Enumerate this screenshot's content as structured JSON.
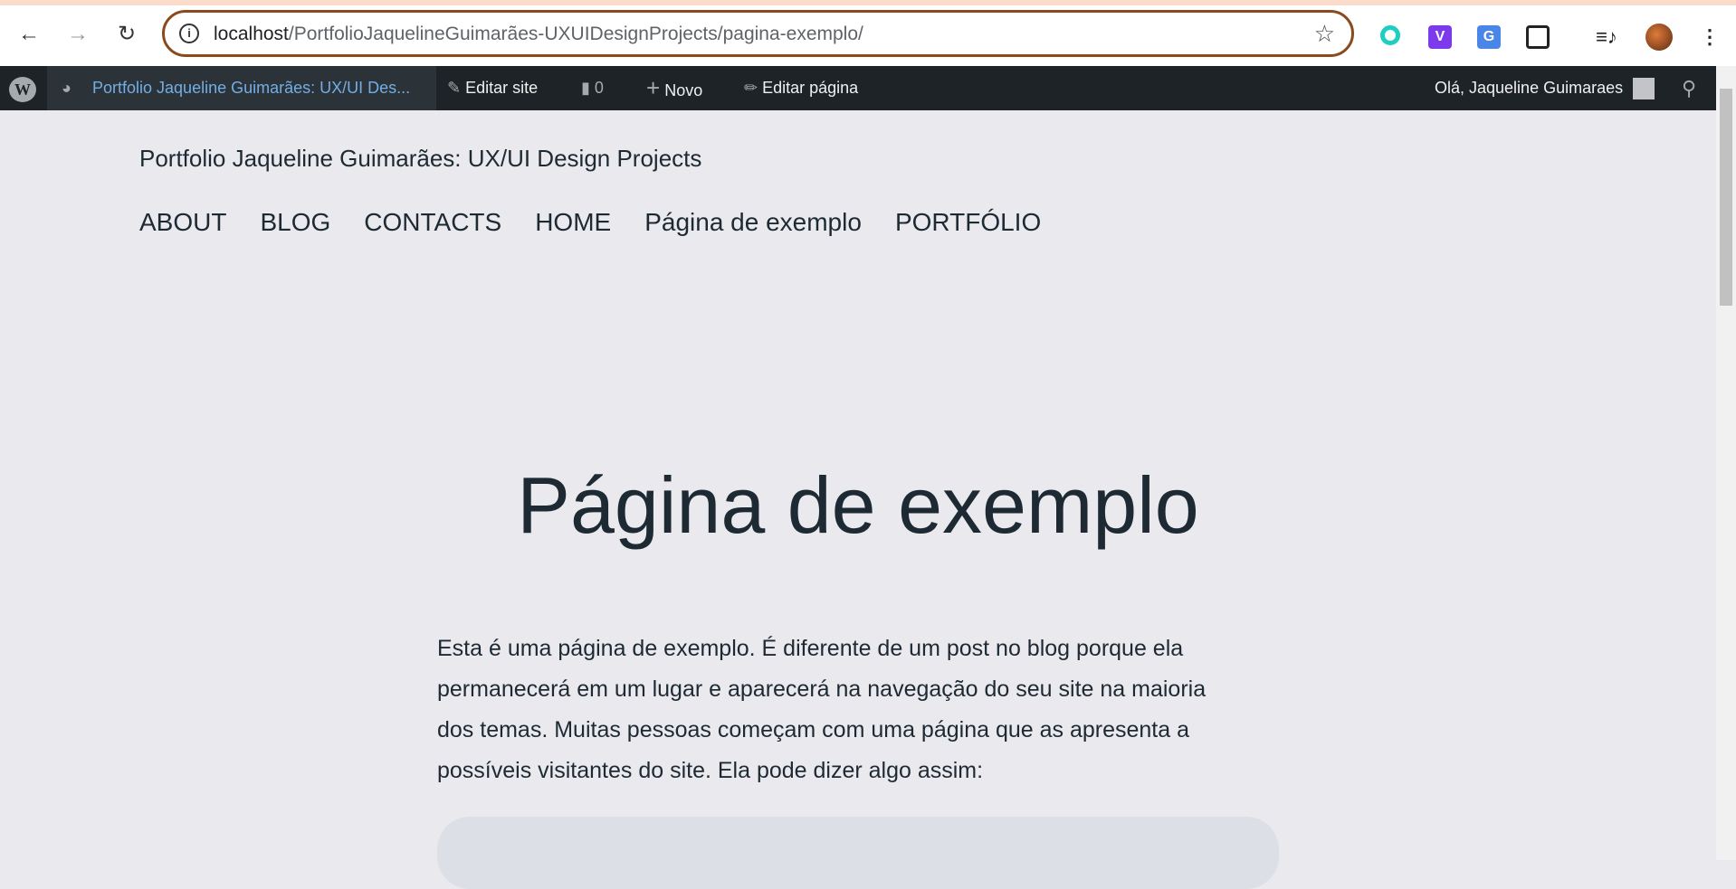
{
  "browser": {
    "url_host": "localhost",
    "url_path": "/PortfolioJaquelineGuimarães-UXUIDesignProjects/pagina-exemplo/",
    "icons": [
      "back-icon",
      "forward-icon",
      "reload-icon",
      "site-info-icon",
      "bookmark-star-icon",
      "extension-icon",
      "puzzle-extensions-icon",
      "media-icon",
      "profile-avatar",
      "more-menu-icon"
    ],
    "ext_v": "V",
    "ext_g": "G"
  },
  "adminbar": {
    "site": "Portfolio Jaqueline Guimarães: UX/UI Des...",
    "edit_site": "Editar site",
    "comments": "0",
    "new": "Novo",
    "edit_page": "Editar página",
    "greeting": "Olá, Jaqueline Guimaraes"
  },
  "site": {
    "title": "Portfolio Jaqueline Guimarães: UX/UI Design Projects",
    "menu": [
      "ABOUT",
      "BLOG",
      "CONTACTS",
      "HOME",
      "Página de exemplo",
      "PORTFÓLIO"
    ]
  },
  "page": {
    "title": "Página de exemplo",
    "paragraph_lines": [
      "Esta é uma página de exemplo. É diferente de um post no blog porque ela",
      "permanecerá em um lugar e aparecerá na navegação do seu site na maioria",
      "dos temas. Muitas pessoas começam com uma página que as apresenta a",
      "possíveis visitantes do site. Ela pode dizer algo assim:"
    ]
  },
  "colors": {
    "adminbar": "#1d2327",
    "accent": "#72aee6",
    "text": "#1e2a33",
    "background": "#eae9ed",
    "omnibox_border": "#8b4a1c"
  }
}
